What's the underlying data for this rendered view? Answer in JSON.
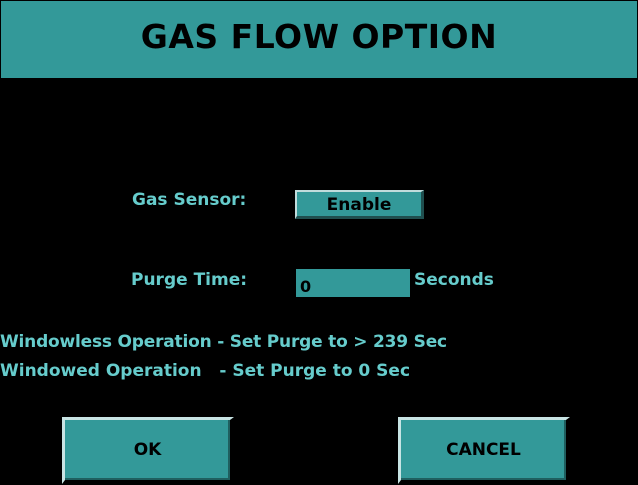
{
  "window": {
    "title": "GAS FLOW OPTION"
  },
  "gas_sensor": {
    "label": "Gas Sensor:",
    "button_label": "Enable"
  },
  "purge_time": {
    "label": "Purge Time:",
    "value": "0",
    "unit": "Seconds"
  },
  "info": {
    "line1": "Windowless Operation - Set Purge to > 239 Sec",
    "line2": "Windowed Operation   - Set Purge to 0 Sec"
  },
  "actions": {
    "ok_label": "OK",
    "cancel_label": "CANCEL"
  },
  "colors": {
    "accent": "#339999",
    "text": "#66cccc",
    "background": "#000000"
  }
}
